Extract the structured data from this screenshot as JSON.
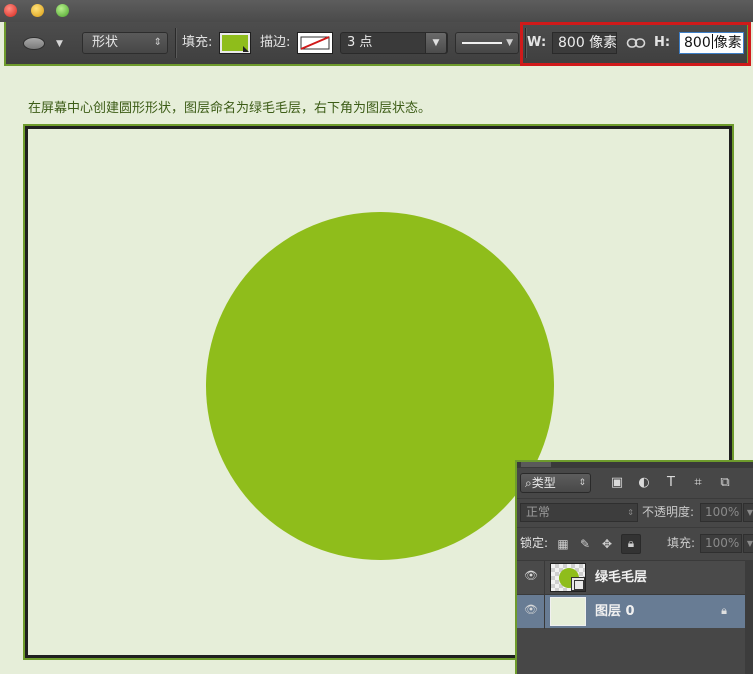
{
  "options_bar": {
    "tool_icon": "ellipse-tool-icon",
    "shape_mode": "形状",
    "fill_label": "填充:",
    "fill_color": "#8fbd1b",
    "stroke_label": "描边:",
    "stroke_size": "3 点",
    "width_label": "W:",
    "width_value": "800 像素",
    "link_icon": "link-icon",
    "height_label": "H:",
    "height_value": "800",
    "height_unit": "像素"
  },
  "instruction": "在屏幕中心创建圆形形状，图层命名为绿毛毛层，右下角为图层状态。",
  "canvas": {
    "circle_color": "#8fbd1b"
  },
  "layers_panel": {
    "kind_filter": "类型",
    "blend_mode": "正常",
    "opacity_label": "不透明度:",
    "opacity_value": "100%",
    "lock_label": "锁定:",
    "fill_label": "填充:",
    "fill_value": "100%",
    "layers": [
      {
        "name": "绿毛毛层",
        "type": "shape",
        "visible": true,
        "selected": false
      },
      {
        "name": "图层 0",
        "type": "pixel",
        "visible": true,
        "selected": true,
        "locked": true
      }
    ]
  },
  "colors": {
    "accent_green": "#6e9b2c",
    "highlight_red": "#d01a1a",
    "selected_layer": "#687c94"
  }
}
